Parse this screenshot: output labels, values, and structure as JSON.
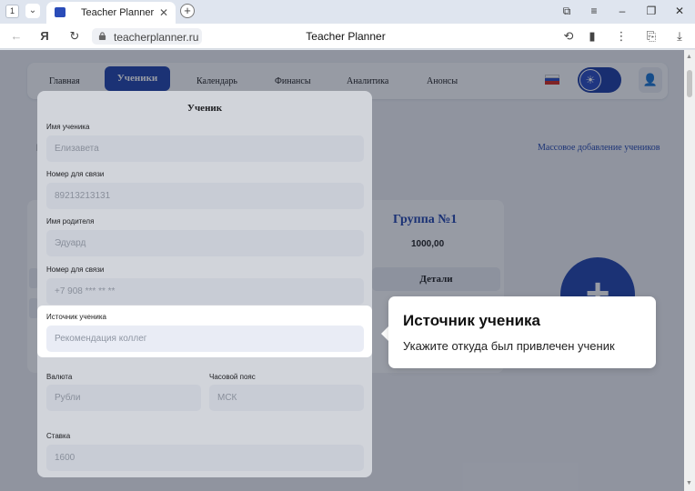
{
  "browser": {
    "tab_count": "1",
    "tab_title": "Teacher Planner",
    "url": "teacherplanner.ru",
    "page_title": "Teacher Planner"
  },
  "nav": {
    "items": [
      "Главная",
      "Ученики",
      "Календарь",
      "Финансы",
      "Аналитика",
      "Анонсы"
    ],
    "active": "Ученики"
  },
  "page": {
    "bulk_add_link": "Массовое добавление учеников",
    "left_stub": "Г"
  },
  "group_card": {
    "title": "Группа №1",
    "price": "1000,00",
    "details_label": "Детали"
  },
  "modal": {
    "title": "Ученик",
    "fields": {
      "name": {
        "label": "Имя ученика",
        "value": "Елизавета"
      },
      "phone": {
        "label": "Номер для связи",
        "value": "89213213131"
      },
      "parent_name": {
        "label": "Имя родителя",
        "value": "Эдуард"
      },
      "parent_phone": {
        "label": "Номер для связи",
        "value": "+7 908 *** ** **"
      },
      "source": {
        "label": "Источник ученика",
        "value": "Рекомендация коллег"
      },
      "currency": {
        "label": "Валюта",
        "value": "Рубли"
      },
      "timezone": {
        "label": "Часовой пояс",
        "value": "МСК"
      },
      "rate": {
        "label": "Ставка",
        "value": "1600"
      }
    }
  },
  "tooltip": {
    "title": "Источник ученика",
    "text": "Укажите откуда был привлечен ученик"
  },
  "colors": {
    "accent": "#2346ad",
    "overlay": "rgba(20,28,48,0.36)"
  }
}
